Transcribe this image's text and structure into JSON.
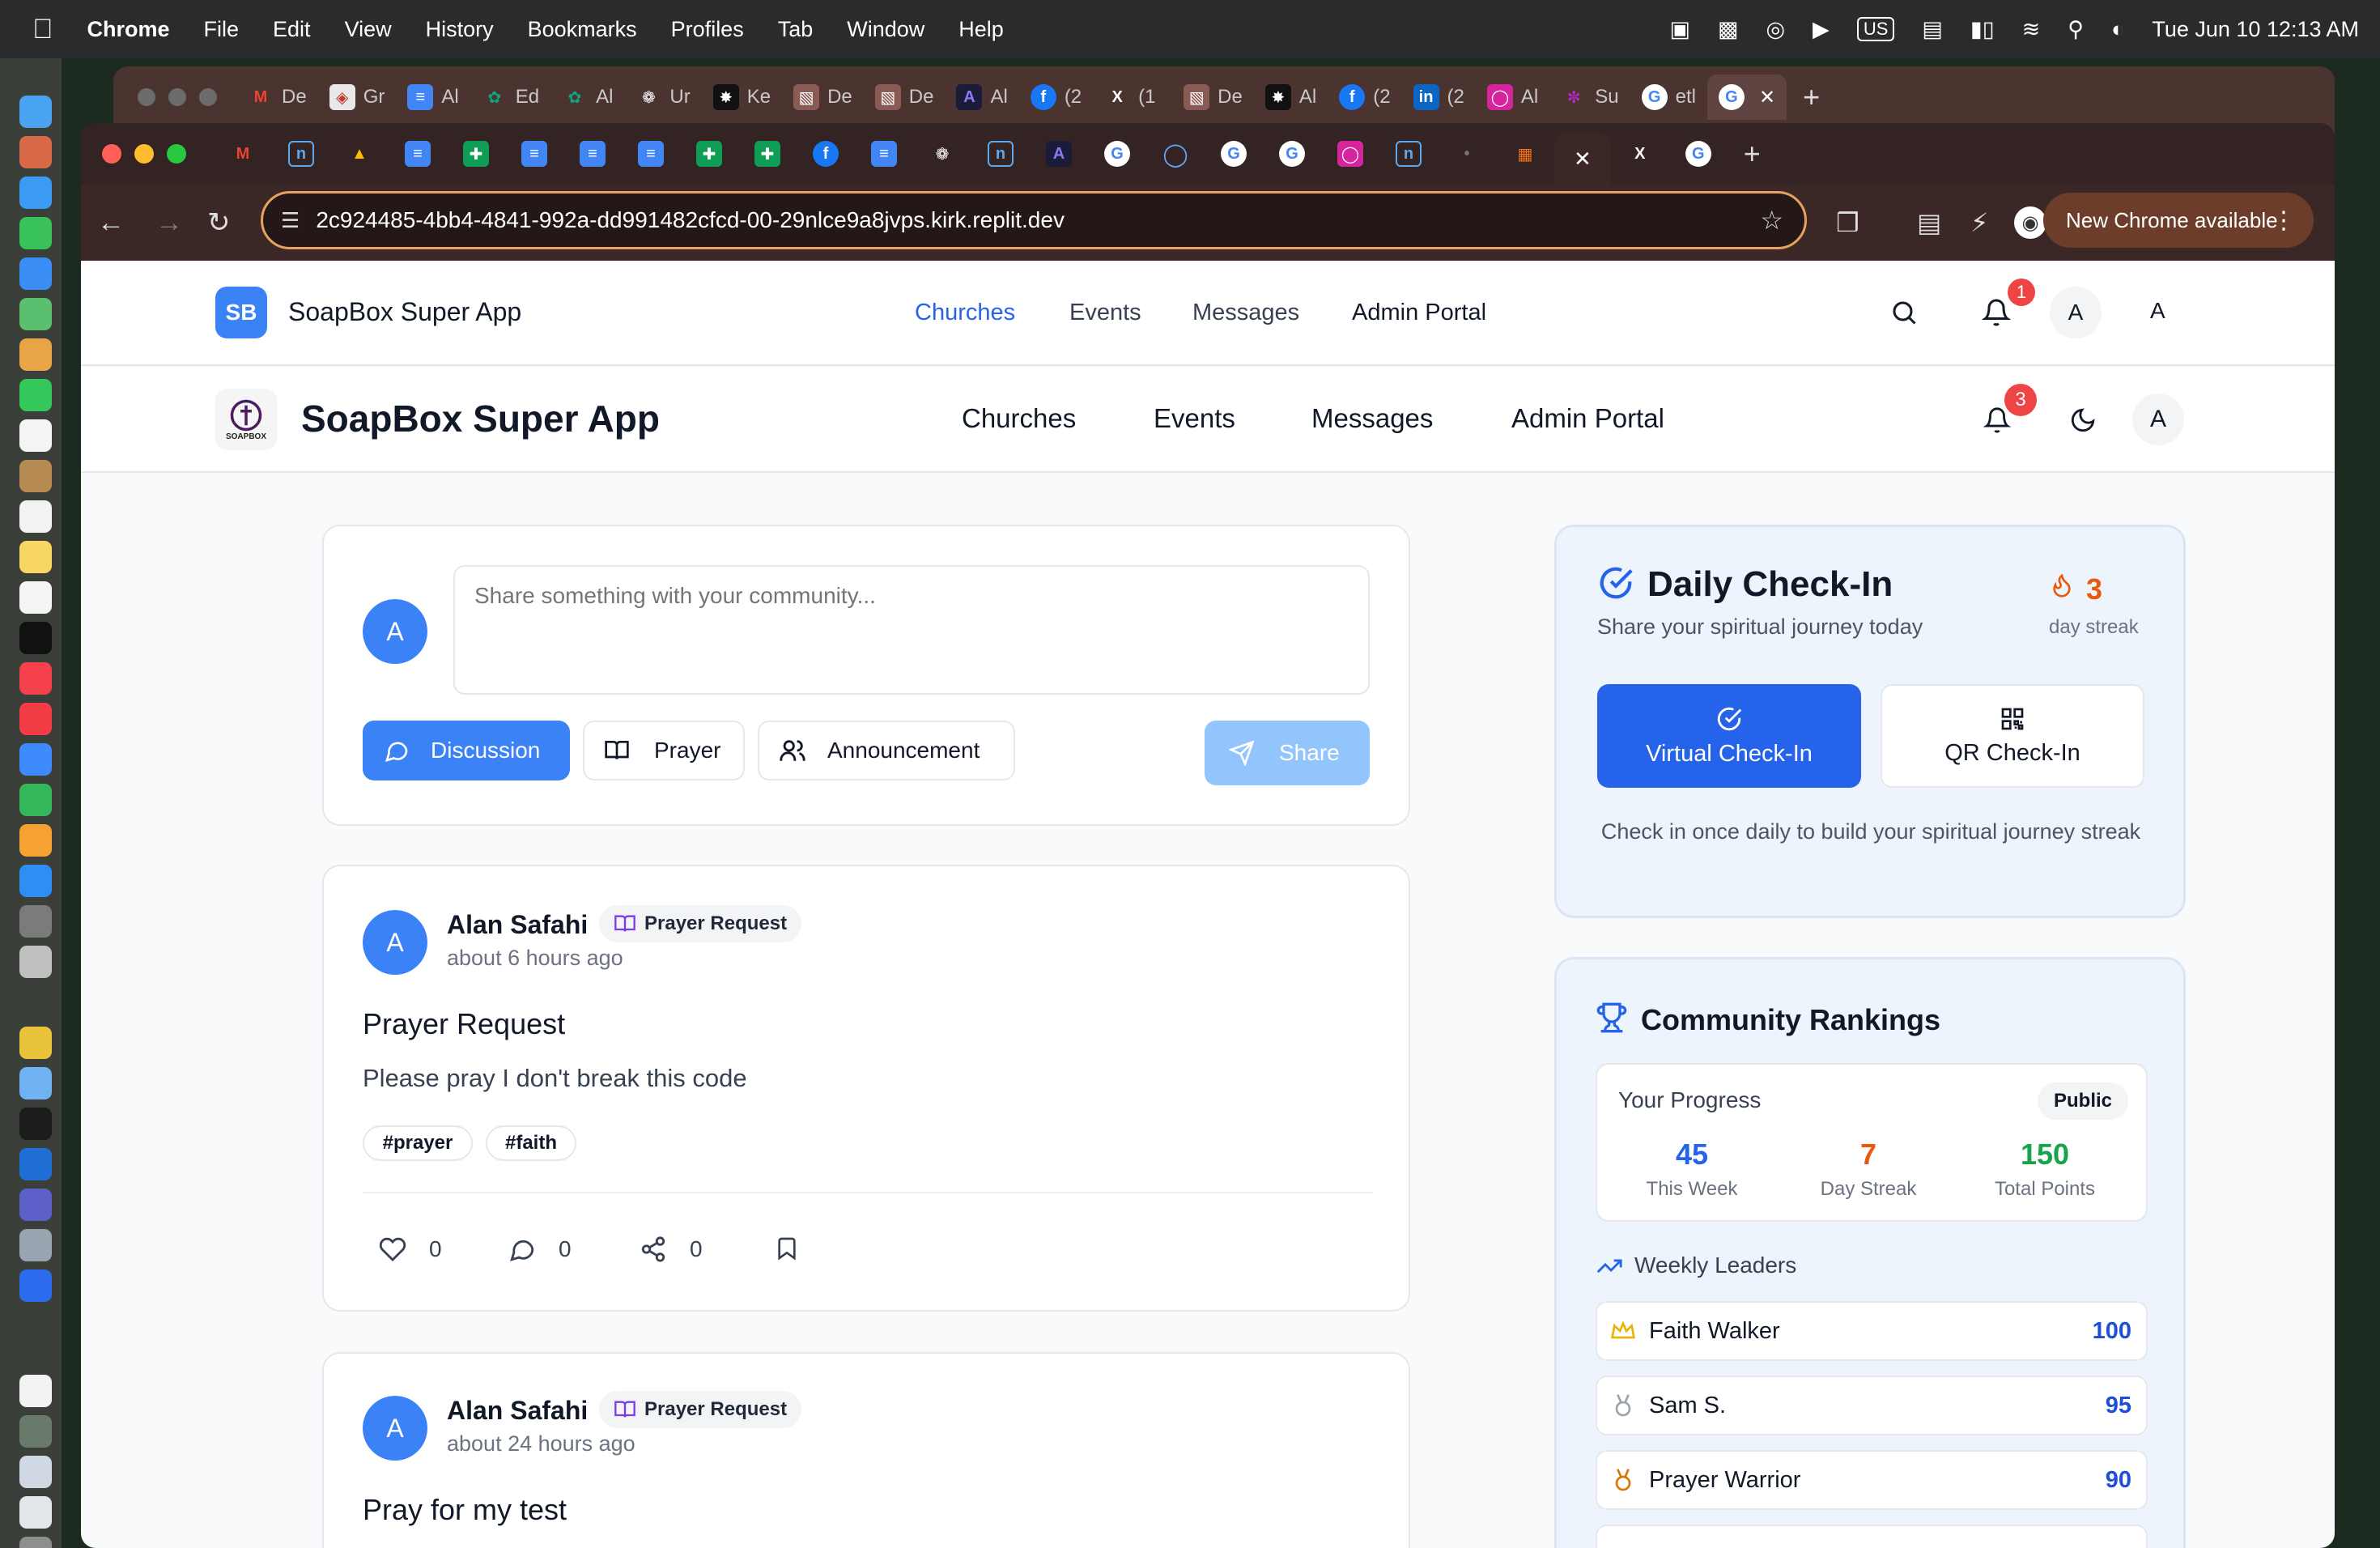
{
  "macos": {
    "app_name": "Chrome",
    "menu": [
      "File",
      "Edit",
      "View",
      "History",
      "Bookmarks",
      "Profiles",
      "Tab",
      "Window",
      "Help"
    ],
    "input_source": "US",
    "datetime": "Tue Jun 10  12:13 AM"
  },
  "back_window_tabs": [
    "De",
    "Gr",
    "Al",
    "Ed",
    "Al",
    "Ur",
    "Ke",
    "De",
    "De",
    "Al",
    "(2",
    "(1 ",
    "De",
    "Al",
    "(2",
    "(2",
    "Al",
    "Su",
    "etl"
  ],
  "front_window": {
    "url": "2c924485-4bb4-4841-992a-dd991482cfcd-00-29nlce9a8jvps.kirk.replit.dev",
    "new_chrome_label": "New Chrome available"
  },
  "app": {
    "logo_initials": "SB",
    "logo_small_text": "SOAPBOX",
    "name": "SoapBox Super App",
    "nav": [
      "Churches",
      "Events",
      "Messages",
      "Admin Portal"
    ],
    "header1_notifications": "1",
    "header2_notifications": "3",
    "avatar_initial": "A",
    "user_initial_text": "A"
  },
  "composer": {
    "placeholder": "Share something with your community...",
    "types": [
      "Discussion",
      "Prayer",
      "Announcement"
    ],
    "share_label": "Share"
  },
  "posts": [
    {
      "author": "Alan Safahi",
      "badge": "Prayer Request",
      "time": "about 6 hours ago",
      "title": "Prayer Request",
      "body": "Please pray I don't break this code",
      "tags": [
        "#prayer",
        "#faith"
      ],
      "likes": "0",
      "comments": "0",
      "shares": "0"
    },
    {
      "author": "Alan Safahi",
      "badge": "Prayer Request",
      "time": "about 24 hours ago",
      "title": "Pray for my test"
    }
  ],
  "checkin": {
    "title": "Daily Check-In",
    "subtitle": "Share your spiritual journey today",
    "streak": "3",
    "streak_label": "day streak",
    "virtual_label": "Virtual Check-In",
    "qr_label": "QR Check-In",
    "note": "Check in once daily to build your spiritual journey streak"
  },
  "rankings": {
    "title": "Community Rankings",
    "progress_label": "Your Progress",
    "visibility": "Public",
    "stats": [
      {
        "value": "45",
        "label": "This Week",
        "color": "#2563eb"
      },
      {
        "value": "7",
        "label": "Day Streak",
        "color": "#ea580c"
      },
      {
        "value": "150",
        "label": "Total Points",
        "color": "#16a34a"
      }
    ],
    "weekly_label": "Weekly Leaders",
    "leaders": [
      {
        "name": "Faith Walker",
        "points": "100"
      },
      {
        "name": "Sam S.",
        "points": "95"
      },
      {
        "name": "Prayer Warrior",
        "points": "90"
      }
    ]
  },
  "colors": {
    "primary": "#3b82f6",
    "primary_dark": "#2563eb",
    "streak": "#ea580c",
    "badge_red": "#ef4444"
  }
}
